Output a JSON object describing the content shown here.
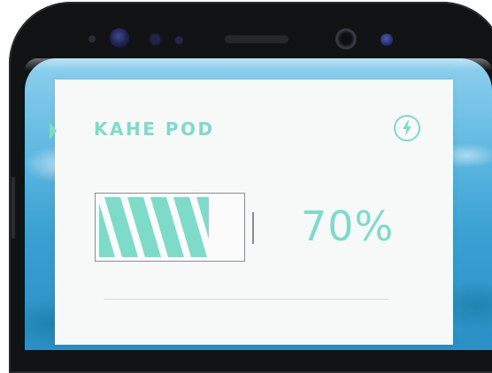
{
  "device": {
    "name": "KAHE POD",
    "battery_percent_label": "70%",
    "battery_level": 0.7
  },
  "icons": {
    "charge": "lightning-bolt-icon"
  },
  "colors": {
    "accent": "#7ddcc8",
    "card_background": "#f7f8f8",
    "battery_outline": "#8a8d90"
  }
}
